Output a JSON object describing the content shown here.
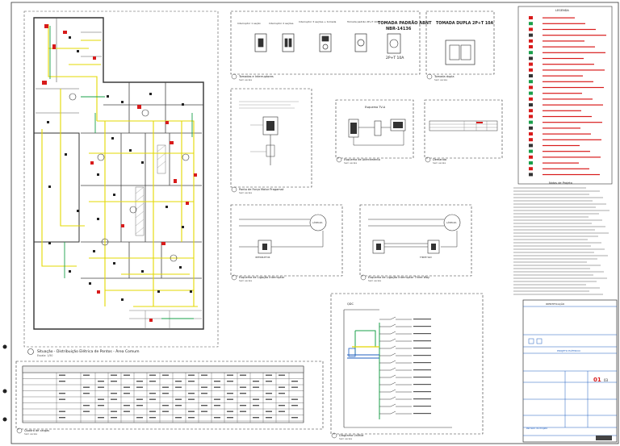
{
  "sheet": {
    "sheet_number": "01",
    "sheet_total": "03",
    "company_label": "Parceiro do Projeto"
  },
  "floor_plan": {
    "title": "Situação - Distribuição Elétrica de Pontos - Área Comum",
    "scale": "Escala: 1/50"
  },
  "details": {
    "tomadas": {
      "title": "Tomadas e Interruptores",
      "scale": "Sem escala",
      "items": [
        "Interruptor 1 seção",
        "Interruptor 2 seções",
        "Interruptor 3 seções + tomada",
        "Tomada padrão 2P+T 10A"
      ],
      "big_label_1": "TOMADA PADRÃO ABNT",
      "big_label_2": "NBR-14136",
      "big_label_3": "2P+T 10A"
    },
    "tomada_dupla": {
      "title": "TOMADA DUPLA 2P+T 10A",
      "caption": "Tomada dupla",
      "scale": "Sem escala"
    },
    "ponto_forca": {
      "title": "Ponto de Força Motor Pragamat",
      "scale": "Sem escala"
    },
    "tv": {
      "title": "Esquema TV-A",
      "caption": "Esquema de Aterramento",
      "scale": "Sem escala"
    },
    "demanda": {
      "caption": "Demanda",
      "scale": "Sem escala"
    },
    "lig_interruptor": {
      "caption": "Esquema de Ligação Interruptor",
      "scale": "Sem escala",
      "lamp_label": "LÂMPADA",
      "switch_label": "INTERRUPTOR"
    },
    "lig_threeway": {
      "caption": "Esquema de Ligação Interruptor Three Way",
      "scale": "Sem escala",
      "lamp_label": "LÂMPADA",
      "switch_label": "THREE WAY"
    },
    "unifilar": {
      "caption": "Diagrama Unifilar",
      "scale": "Sem escala",
      "header": "QDC"
    },
    "cargas": {
      "caption": "Quadro de cargas",
      "scale": "Sem escala"
    }
  },
  "legend": {
    "title": "LEGENDA",
    "notes_title": "Notas de Projeto"
  },
  "title_block": {
    "header": "IDENTIFICAÇÃO",
    "project_label": "PROJETO ELÉTRICO"
  },
  "colors": {
    "line": "#222222",
    "wire_yellow": "#e3d800",
    "wire_green": "#1aa04a",
    "wire_red": "#d81b1b",
    "accent_blue": "#1f5fbf"
  }
}
